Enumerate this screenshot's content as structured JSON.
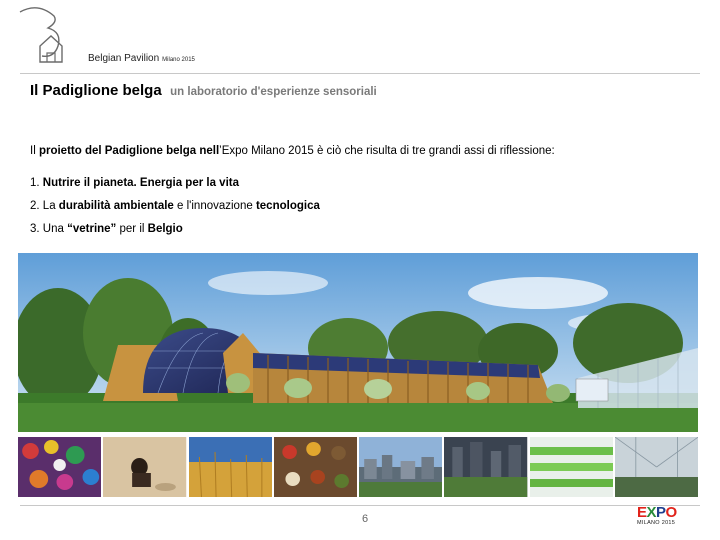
{
  "header": {
    "brand_name": "Belgian Pavilion",
    "brand_sub": "Milano 2015"
  },
  "title": {
    "main": "Il Padiglione belga",
    "sub": "un laboratorio d'esperienze sensoriali"
  },
  "intro": {
    "part1": "Il ",
    "bold1": "proietto del Padiglione belga nell",
    "part2": "’Expo Milano 2015 è ciò che risulta di tre grandi assi di riflessione:"
  },
  "points": [
    {
      "num": "1. ",
      "pre": "",
      "bold": "Nutrire il pianeta. Energia per la vita",
      "mid": "",
      "bold2": ""
    },
    {
      "num": "2. ",
      "pre": "La ",
      "bold": "durabilità ambientale",
      "mid": " e l'innovazione ",
      "bold2": "tecnologica"
    },
    {
      "num": "3.  ",
      "pre": "Una ",
      "bold": "“vetrine”",
      "mid": " per il ",
      "bold2": "Belgio"
    }
  ],
  "images": {
    "hero": "belgian-pavilion-rendering",
    "thumbnails": [
      "colorful-beads",
      "child-in-sand",
      "wheat-field",
      "spices-spoons",
      "city-rooftops",
      "urban-garden",
      "hydroponic-greens",
      "greenhouse-interior"
    ]
  },
  "footer": {
    "page_number": "6",
    "expo_word": "EXPO",
    "expo_sub": "MILANO 2015",
    "expo_colors": [
      "#e1231b",
      "#2a8c3c",
      "#1f3f8f",
      "#e1231b"
    ]
  }
}
